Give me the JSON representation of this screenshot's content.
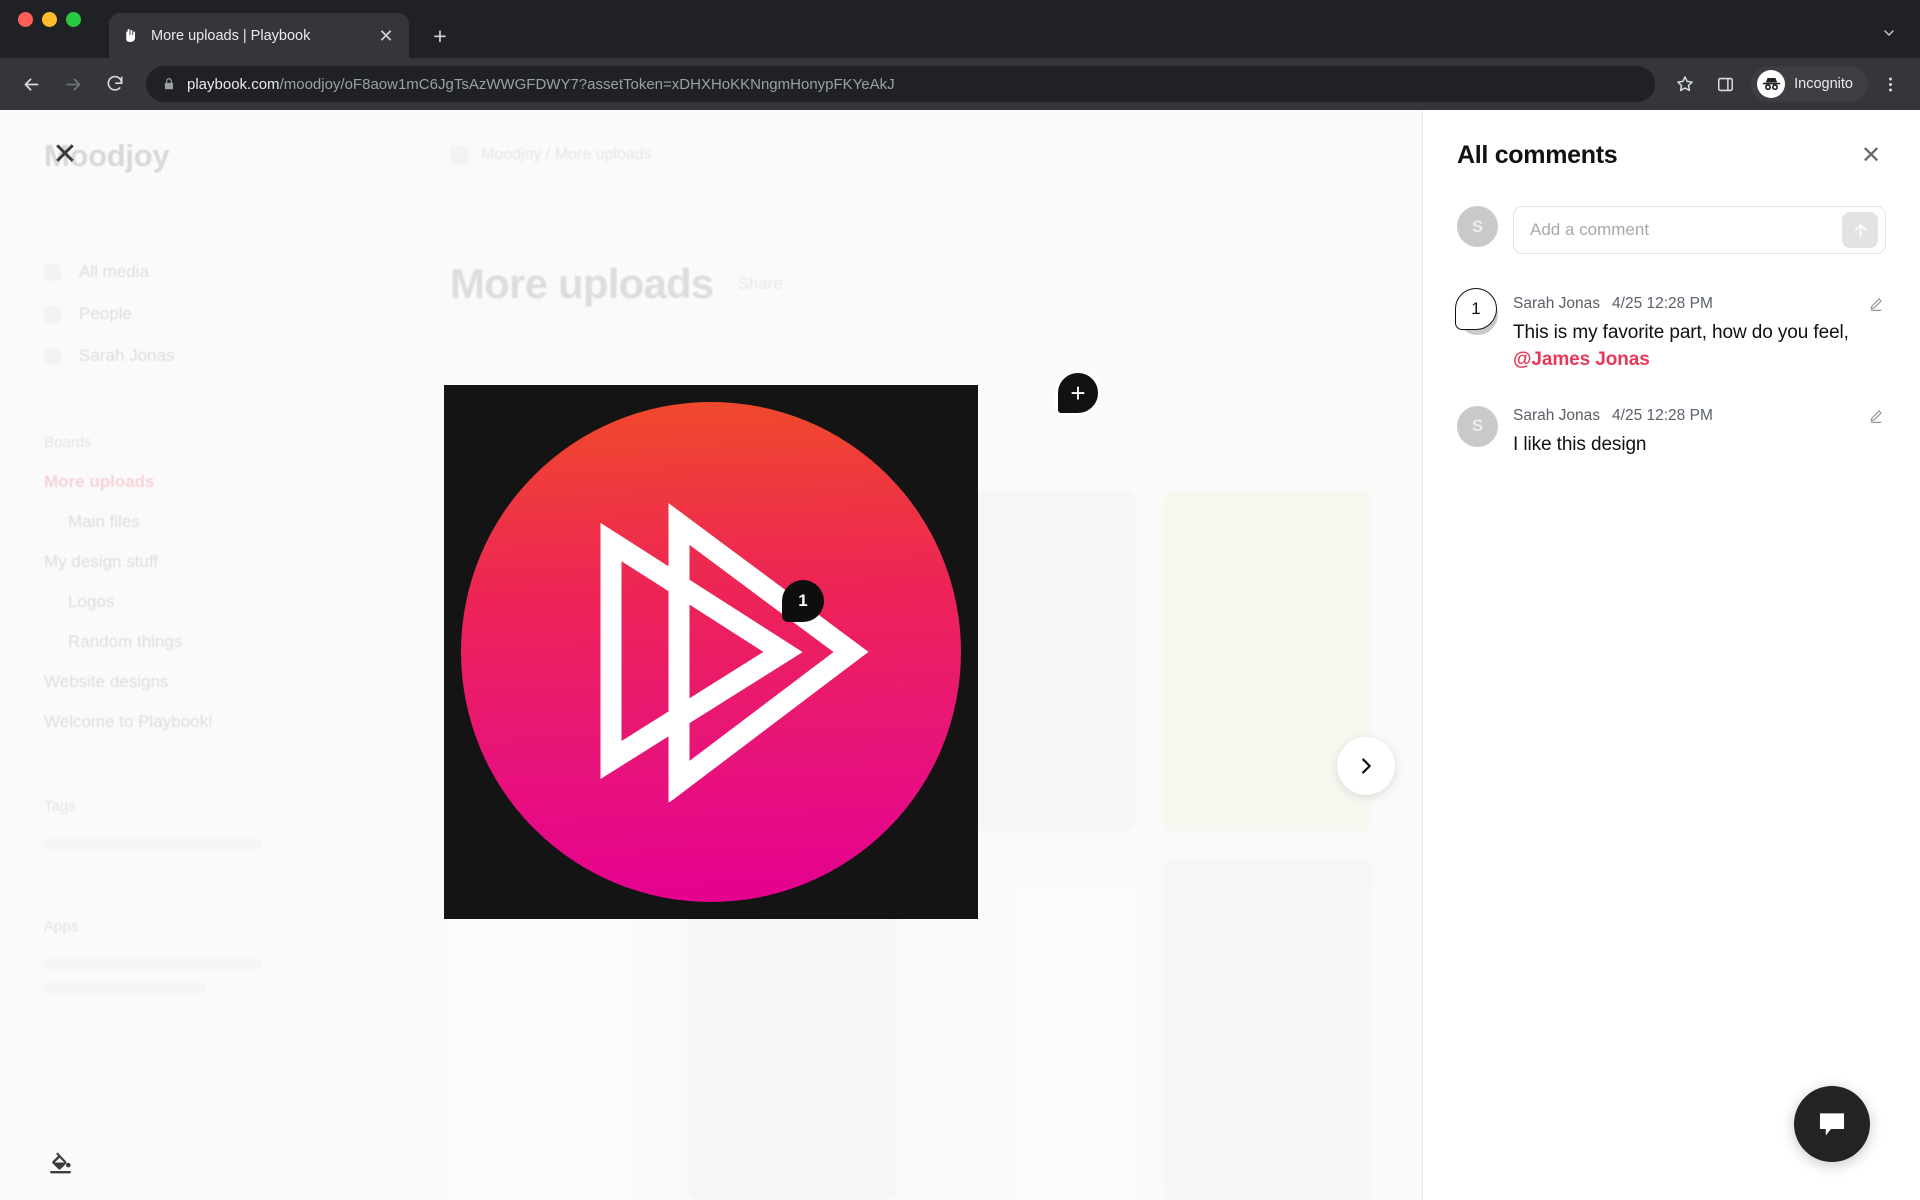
{
  "browser": {
    "tab": {
      "title": "More uploads | Playbook",
      "favicon_icon": "playbook-hand-icon",
      "close_icon": "close-icon"
    },
    "new_tab_icon": "plus-icon",
    "tabstrip_menu_icon": "chevron-down-icon",
    "back_icon": "arrow-left-icon",
    "forward_icon": "arrow-right-icon",
    "reload_icon": "reload-icon",
    "lock_icon": "lock-icon",
    "url_host": "playbook.com",
    "url_path": "/moodjoy/oF8aow1mC6JgTsAzWWGFDWY7?assetToken=xDHXHoKKNngmHonypFKYeAkJ",
    "bookmark_icon": "star-icon",
    "sidepanel_icon": "side-panel-icon",
    "incognito_label": "Incognito",
    "incognito_icon": "incognito-icon",
    "menu_icon": "three-dot-menu-icon"
  },
  "app": {
    "close_icon": "close-icon",
    "brand": "Moodjoy",
    "sidebar": {
      "nav": [
        {
          "label": "All media",
          "icon": "media-icon"
        },
        {
          "label": "People",
          "icon": "people-icon"
        },
        {
          "label": "Sarah Jonas",
          "icon": "user-icon"
        }
      ],
      "boards_section": "Boards",
      "boards": [
        {
          "label": "More uploads",
          "active": true,
          "indent": false
        },
        {
          "label": "Main files",
          "active": false,
          "indent": true
        },
        {
          "label": "My design stuff",
          "active": false,
          "indent": false
        },
        {
          "label": "Logos",
          "active": false,
          "indent": true
        },
        {
          "label": "Random things",
          "active": false,
          "indent": true
        },
        {
          "label": "Website designs",
          "active": false,
          "indent": false
        },
        {
          "label": "Welcome to Playbook!",
          "active": false,
          "indent": false
        }
      ],
      "section_two": "Tags",
      "section_three": "Apps"
    },
    "breadcrumb": "Moodjoy / More uploads",
    "page_title": "More uploads",
    "share_label": "Share",
    "view_toggle_icon": "layout-toggle-icon",
    "view_expand_icon": "arrow-right-icon",
    "next_asset_icon": "chevron-right-icon",
    "theme_icon": "paint-bucket-icon",
    "chat_icon": "chat-bubble-icon"
  },
  "lightbox": {
    "asset_name": "playbook-logo",
    "background_color": "#141414",
    "gradient_from": "#f04b2a",
    "gradient_to": "#e40091",
    "pin_add_icon": "plus-icon",
    "pin_number": "1"
  },
  "comments": {
    "title": "All comments",
    "close_icon": "close-icon",
    "composer": {
      "avatar_initial": "S",
      "placeholder": "Add a comment",
      "value": "",
      "send_icon": "arrow-up-icon"
    },
    "accent_color": "#e8385a",
    "items": [
      {
        "pin": "1",
        "avatar_initial": "S",
        "author": "Sarah Jonas",
        "time": "4/25 12:28 PM",
        "text": "This is my favorite part, how do you feel,",
        "mention": "@James Jonas",
        "edit_icon": "pencil-icon"
      },
      {
        "pin": "",
        "avatar_initial": "S",
        "author": "Sarah Jonas",
        "time": "4/25 12:28 PM",
        "text": "I like this design",
        "mention": "",
        "edit_icon": "pencil-icon"
      }
    ]
  }
}
